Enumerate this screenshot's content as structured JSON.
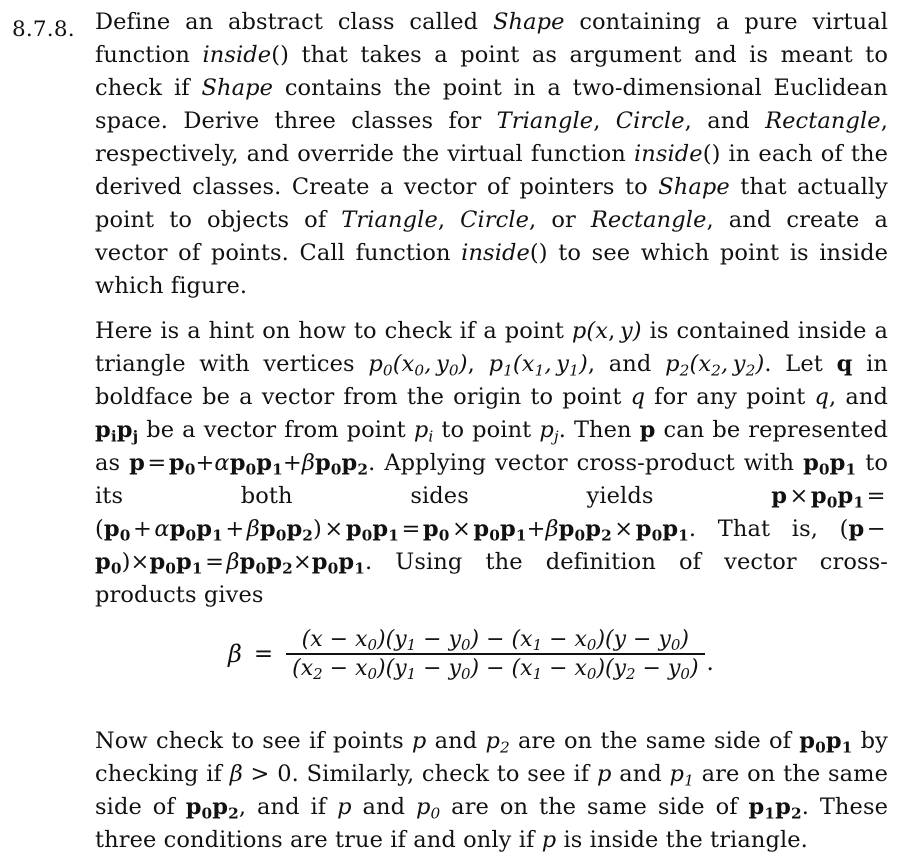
{
  "document": {
    "kind": "textbook-exercise-page",
    "background_color": "#ffffff",
    "text_color": "#111111"
  },
  "exercise": {
    "number": "8.7.8.",
    "paragraph1": {
      "segments": [
        {
          "t": "Define an abstract class called ",
          "s": "roman"
        },
        {
          "t": "Shape",
          "s": "italic"
        },
        {
          "t": " containing a pure virtual function ",
          "s": "roman"
        },
        {
          "t": "inside",
          "s": "italic"
        },
        {
          "t": "() that takes a point as argument and is meant to check if ",
          "s": "roman"
        },
        {
          "t": "Shape",
          "s": "italic"
        },
        {
          "t": " contains the point in a two-dimensional Euclidean space. Derive three classes for ",
          "s": "roman"
        },
        {
          "t": "Triangle",
          "s": "italic"
        },
        {
          "t": ", ",
          "s": "roman"
        },
        {
          "t": "Circle",
          "s": "italic"
        },
        {
          "t": ", and ",
          "s": "roman"
        },
        {
          "t": "Rectangle",
          "s": "italic"
        },
        {
          "t": ", respectively, and override the virtual function ",
          "s": "roman"
        },
        {
          "t": "inside",
          "s": "italic"
        },
        {
          "t": "() in each of the derived classes. Create a vector of pointers to ",
          "s": "roman"
        },
        {
          "t": "Shape",
          "s": "italic"
        },
        {
          "t": " that actually point to objects of ",
          "s": "roman"
        },
        {
          "t": "Triangle",
          "s": "italic"
        },
        {
          "t": ", ",
          "s": "roman"
        },
        {
          "t": "Circle",
          "s": "italic"
        },
        {
          "t": ", or ",
          "s": "roman"
        },
        {
          "t": "Rectangle",
          "s": "italic"
        },
        {
          "t": ", and create a vector of points. Call function ",
          "s": "roman"
        },
        {
          "t": "inside",
          "s": "italic"
        },
        {
          "t": "() to see which point is inside which figure.",
          "s": "roman"
        }
      ],
      "plain_text": "Define an abstract class called Shape containing a pure virtual function inside() that takes a point as argument and is meant to check if Shape contains the point in a two-dimensional Euclidean space. Derive three classes for Triangle, Circle, and Rectangle, respectively, and override the virtual function inside() in each of the derived classes. Create a vector of pointers to Shape that actually point to objects of Triangle, Circle, or Rectangle, and create a vector of points. Call function inside() to see which point is inside which figure."
    },
    "paragraph2": {
      "plain_text": "Here is a hint on how to check if a point p(x, y) is contained inside a triangle with vertices p0(x0, y0), p1(x1, y1), and p2(x2, y2). Let q in boldface be a vector from the origin to point q for any point q, and pipj be a vector from point pi to point pj. Then p can be represented as p = p0+αp0p1+βp0p2. Applying vector cross-product with p0p1 to its both sides yields p × p0p1 = (p0 + αp0p1 + βp0p2) × p0p1 = p0 × p0p1 + βp0p2 × p0p1. That is, (p − p0) × p0p1 = βp0p2 × p0p1. Using the definition of vector cross-products gives",
      "lead": "Here is a hint on how to check if a point ",
      "t_after_pxy": " is contained inside a triangle with vertices ",
      "t_let_q": ". Let ",
      "t_q_boldface": " in boldface be a vector from the origin to point ",
      "t_for_any": " for any point ",
      "t_and": ", and ",
      "t_vector_from": " be a vector from point ",
      "t_to_point": " to point ",
      "t_then": ". Then ",
      "t_can_be": " can be represented as ",
      "t_applying": ". Applying vector cross-product with ",
      "t_to_both": " to its both sides yields ",
      "t_that_is": ". That is, ",
      "t_using": ". Using the definition of vector cross-products gives"
    },
    "equation": {
      "lhs": "β",
      "relation": "=",
      "numerator": "(x − x0)(y1 − y0) − (x1 − x0)(y − y0)",
      "denominator": "(x2 − x0)(y1 − y0) − (x1 − x0)(y2 − y0)",
      "trailing_punctuation": ".",
      "plain_text": "β = [(x − x0)(y1 − y0) − (x1 − x0)(y − y0)] / [(x2 − x0)(y1 − y0) − (x1 − x0)(y2 − y0)]."
    },
    "paragraph3": {
      "plain_text": "Now check to see if points p and p2 are on the same side of p0p1 by checking if β > 0. Similarly, check to see if p and p1 are on the same side of p0p2, and if p and p0 are on the same side of p1p2. These three conditions are true if and only if p is inside the triangle.",
      "t_now": "Now check to see if points ",
      "t_and": " and ",
      "t_same_side": " are on the same side of ",
      "t_by_checking": " by checking if ",
      "t_beta_gt": " > 0. Similarly, check to see if ",
      "t_and2": " and ",
      "t_same_side2": " are on the same side of ",
      "t_and_if": ", and if ",
      "t_and3": " and ",
      "t_same_side3": " are on the same side of ",
      "t_these": ". These three conditions are true if and only if ",
      "t_inside": " is inside the triangle."
    }
  }
}
